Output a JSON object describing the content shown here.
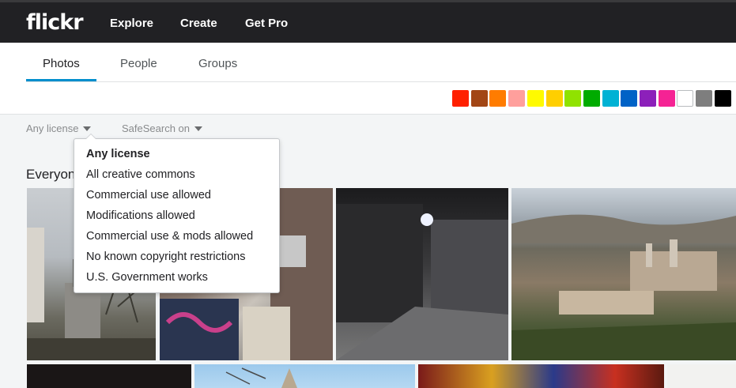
{
  "header": {
    "logo": "flickr",
    "nav": [
      "Explore",
      "Create",
      "Get Pro"
    ]
  },
  "tabs": [
    {
      "label": "Photos",
      "active": true
    },
    {
      "label": "People",
      "active": false
    },
    {
      "label": "Groups",
      "active": false
    }
  ],
  "colors": [
    "#ff2000",
    "#a24615",
    "#ff7c00",
    "#ff9f9c",
    "#fffa00",
    "#ffcf00",
    "#90e200",
    "#00ab00",
    "#00b2d4",
    "#0062c6",
    "#8c20ba",
    "#f52394",
    "#ffffff",
    "#7e7e7e",
    "#000000"
  ],
  "filters": {
    "license": "Any license",
    "safesearch": "SafeSearch on"
  },
  "section_title": "Everyone",
  "license_menu": {
    "items": [
      "Any license",
      "All creative commons",
      "Commercial use allowed",
      "Modifications allowed",
      "Commercial use & mods allowed",
      "No known copyright restrictions",
      "U.S. Government works"
    ],
    "selected": "Any license"
  }
}
